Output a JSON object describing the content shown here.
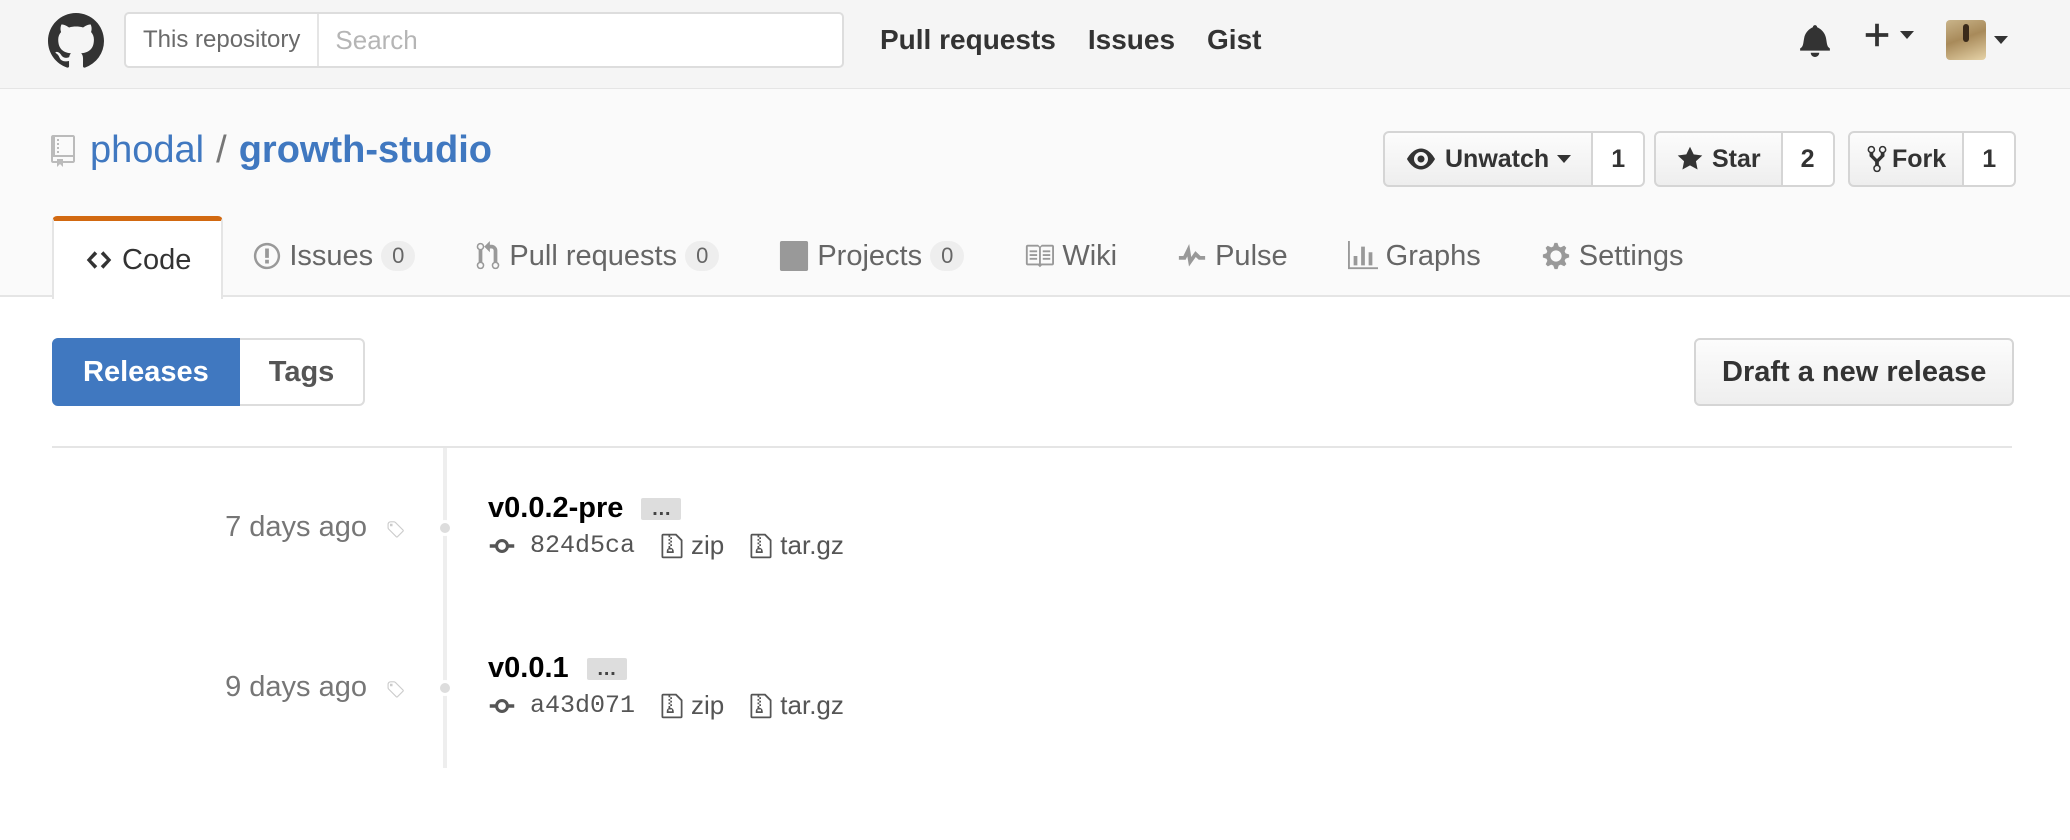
{
  "header": {
    "search_scope": "This repository",
    "search_placeholder": "Search",
    "nav": [
      "Pull requests",
      "Issues",
      "Gist"
    ]
  },
  "repo": {
    "owner": "phodal",
    "separator": "/",
    "name": "growth-studio",
    "actions": {
      "watch": {
        "label": "Unwatch",
        "count": "1"
      },
      "star": {
        "label": "Star",
        "count": "2"
      },
      "fork": {
        "label": "Fork",
        "count": "1"
      }
    },
    "tabs": [
      {
        "label": "Code",
        "icon": "code-icon"
      },
      {
        "label": "Issues",
        "count": "0",
        "icon": "issue-opened-icon"
      },
      {
        "label": "Pull requests",
        "count": "0",
        "icon": "git-pull-request-icon"
      },
      {
        "label": "Projects",
        "count": "0",
        "icon": "project-icon"
      },
      {
        "label": "Wiki",
        "icon": "book-icon"
      },
      {
        "label": "Pulse",
        "icon": "pulse-icon"
      },
      {
        "label": "Graphs",
        "icon": "graph-icon"
      },
      {
        "label": "Settings",
        "icon": "gear-icon"
      }
    ]
  },
  "releases_nav": {
    "releases": "Releases",
    "tags": "Tags",
    "draft": "Draft a new release"
  },
  "releases": [
    {
      "date": "7 days ago",
      "tag": "v0.0.2-pre",
      "more": "…",
      "commit": "824d5ca",
      "zip": "zip",
      "targz": "tar.gz"
    },
    {
      "date": "9 days ago",
      "tag": "v0.0.1",
      "more": "…",
      "commit": "a43d071",
      "zip": "zip",
      "targz": "tar.gz"
    }
  ],
  "colors": {
    "accent": "#4078c0",
    "tab_highlight": "#d26911"
  }
}
